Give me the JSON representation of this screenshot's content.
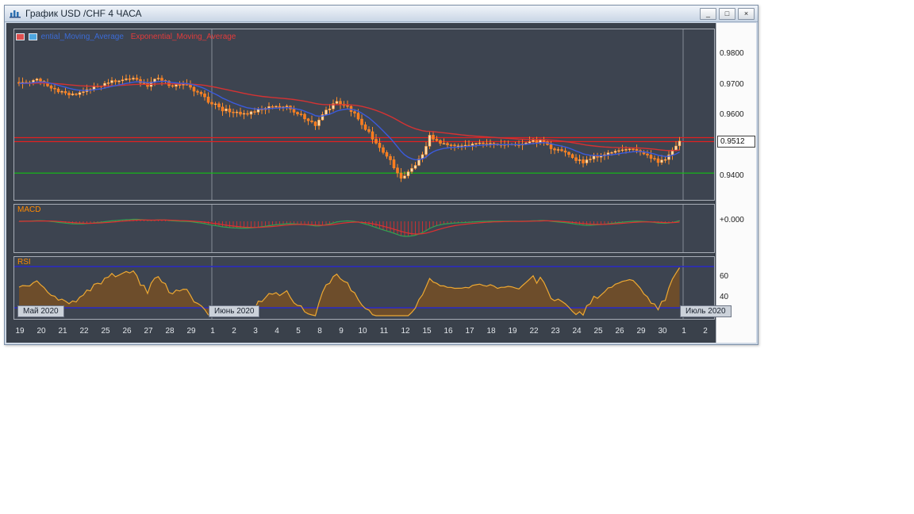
{
  "window": {
    "title": "График USD /CHF 4 ЧАСА",
    "minimize_glyph": "_",
    "restore_glyph": "□",
    "close_glyph": "×"
  },
  "legend": {
    "ma_fast_label": "ential_Moving_Average",
    "ma_slow_label": "Exponential_Moving_Average"
  },
  "panels": {
    "macd_label": "MACD",
    "rsi_label": "RSI"
  },
  "scale": {
    "price_labels": [
      {
        "text": "0.9800",
        "price": 0.98
      },
      {
        "text": "0.9700",
        "price": 0.97
      },
      {
        "text": "0.9600",
        "price": 0.96
      },
      {
        "text": "0.9400",
        "price": 0.94
      }
    ],
    "current_price_text": "0.9512",
    "current_price": 0.9512,
    "macd_zero_label": "+0.000",
    "rsi_labels": [
      {
        "text": "60",
        "value": 60
      },
      {
        "text": "40",
        "value": 40
      }
    ]
  },
  "axis": {
    "dates": [
      "19",
      "20",
      "21",
      "22",
      "25",
      "26",
      "27",
      "28",
      "29",
      "1",
      "2",
      "3",
      "4",
      "5",
      "8",
      "9",
      "10",
      "11",
      "12",
      "15",
      "16",
      "17",
      "18",
      "19",
      "22",
      "23",
      "24",
      "25",
      "26",
      "29",
      "30",
      "1",
      "2"
    ],
    "months": [
      {
        "label": "Май 2020",
        "bar": 0
      },
      {
        "label": "Июнь 2020",
        "bar": 54
      },
      {
        "label": "Июль 2020",
        "bar": 186
      }
    ]
  },
  "chart": {
    "bar_count": 186,
    "price_anchors": [
      [
        0,
        0.9705
      ],
      [
        5,
        0.9716
      ],
      [
        9,
        0.9688
      ],
      [
        14,
        0.9662
      ],
      [
        20,
        0.9685
      ],
      [
        27,
        0.9712
      ],
      [
        32,
        0.972
      ],
      [
        36,
        0.9695
      ],
      [
        39,
        0.9722
      ],
      [
        43,
        0.9692
      ],
      [
        46,
        0.9703
      ],
      [
        50,
        0.9675
      ],
      [
        53,
        0.9645
      ],
      [
        57,
        0.9618
      ],
      [
        63,
        0.9603
      ],
      [
        69,
        0.9622
      ],
      [
        75,
        0.9626
      ],
      [
        80,
        0.9592
      ],
      [
        83,
        0.957
      ],
      [
        86,
        0.9612
      ],
      [
        89,
        0.9642
      ],
      [
        92,
        0.963
      ],
      [
        95,
        0.9588
      ],
      [
        98,
        0.954
      ],
      [
        101,
        0.949
      ],
      [
        104,
        0.9448
      ],
      [
        107,
        0.9398
      ],
      [
        110,
        0.9422
      ],
      [
        113,
        0.9472
      ],
      [
        115,
        0.9532
      ],
      [
        119,
        0.9504
      ],
      [
        125,
        0.9499
      ],
      [
        130,
        0.9507
      ],
      [
        136,
        0.9499
      ],
      [
        141,
        0.9506
      ],
      [
        146,
        0.9517
      ],
      [
        149,
        0.9494
      ],
      [
        154,
        0.9468
      ],
      [
        158,
        0.9443
      ],
      [
        161,
        0.9462
      ],
      [
        166,
        0.9477
      ],
      [
        171,
        0.9487
      ],
      [
        176,
        0.9468
      ],
      [
        179,
        0.9448
      ],
      [
        182,
        0.9465
      ],
      [
        185,
        0.9512
      ]
    ],
    "levels": {
      "resistance": [
        0.9526,
        0.9513
      ],
      "support": 0.941
    },
    "rsi_levels": [
      70,
      30
    ],
    "grid_vline_bars": [
      54,
      186
    ],
    "colors": {
      "bull": "#ffdfae",
      "bear": "#ff7a1e",
      "wick": "#ff8c28",
      "ema_fast": "#3b5bdc",
      "ema_slow": "#d43333",
      "resistance": "#e02020",
      "support": "#12c212",
      "macd_line": "#2fa352",
      "macd_signal": "#e03030",
      "macd_hist": "#c83232",
      "rsi_line": "#eda832",
      "rsi_fill": "rgba(150,86,12,0.55)",
      "rsi_level": "#2929c8",
      "grid": "#858b96"
    }
  }
}
